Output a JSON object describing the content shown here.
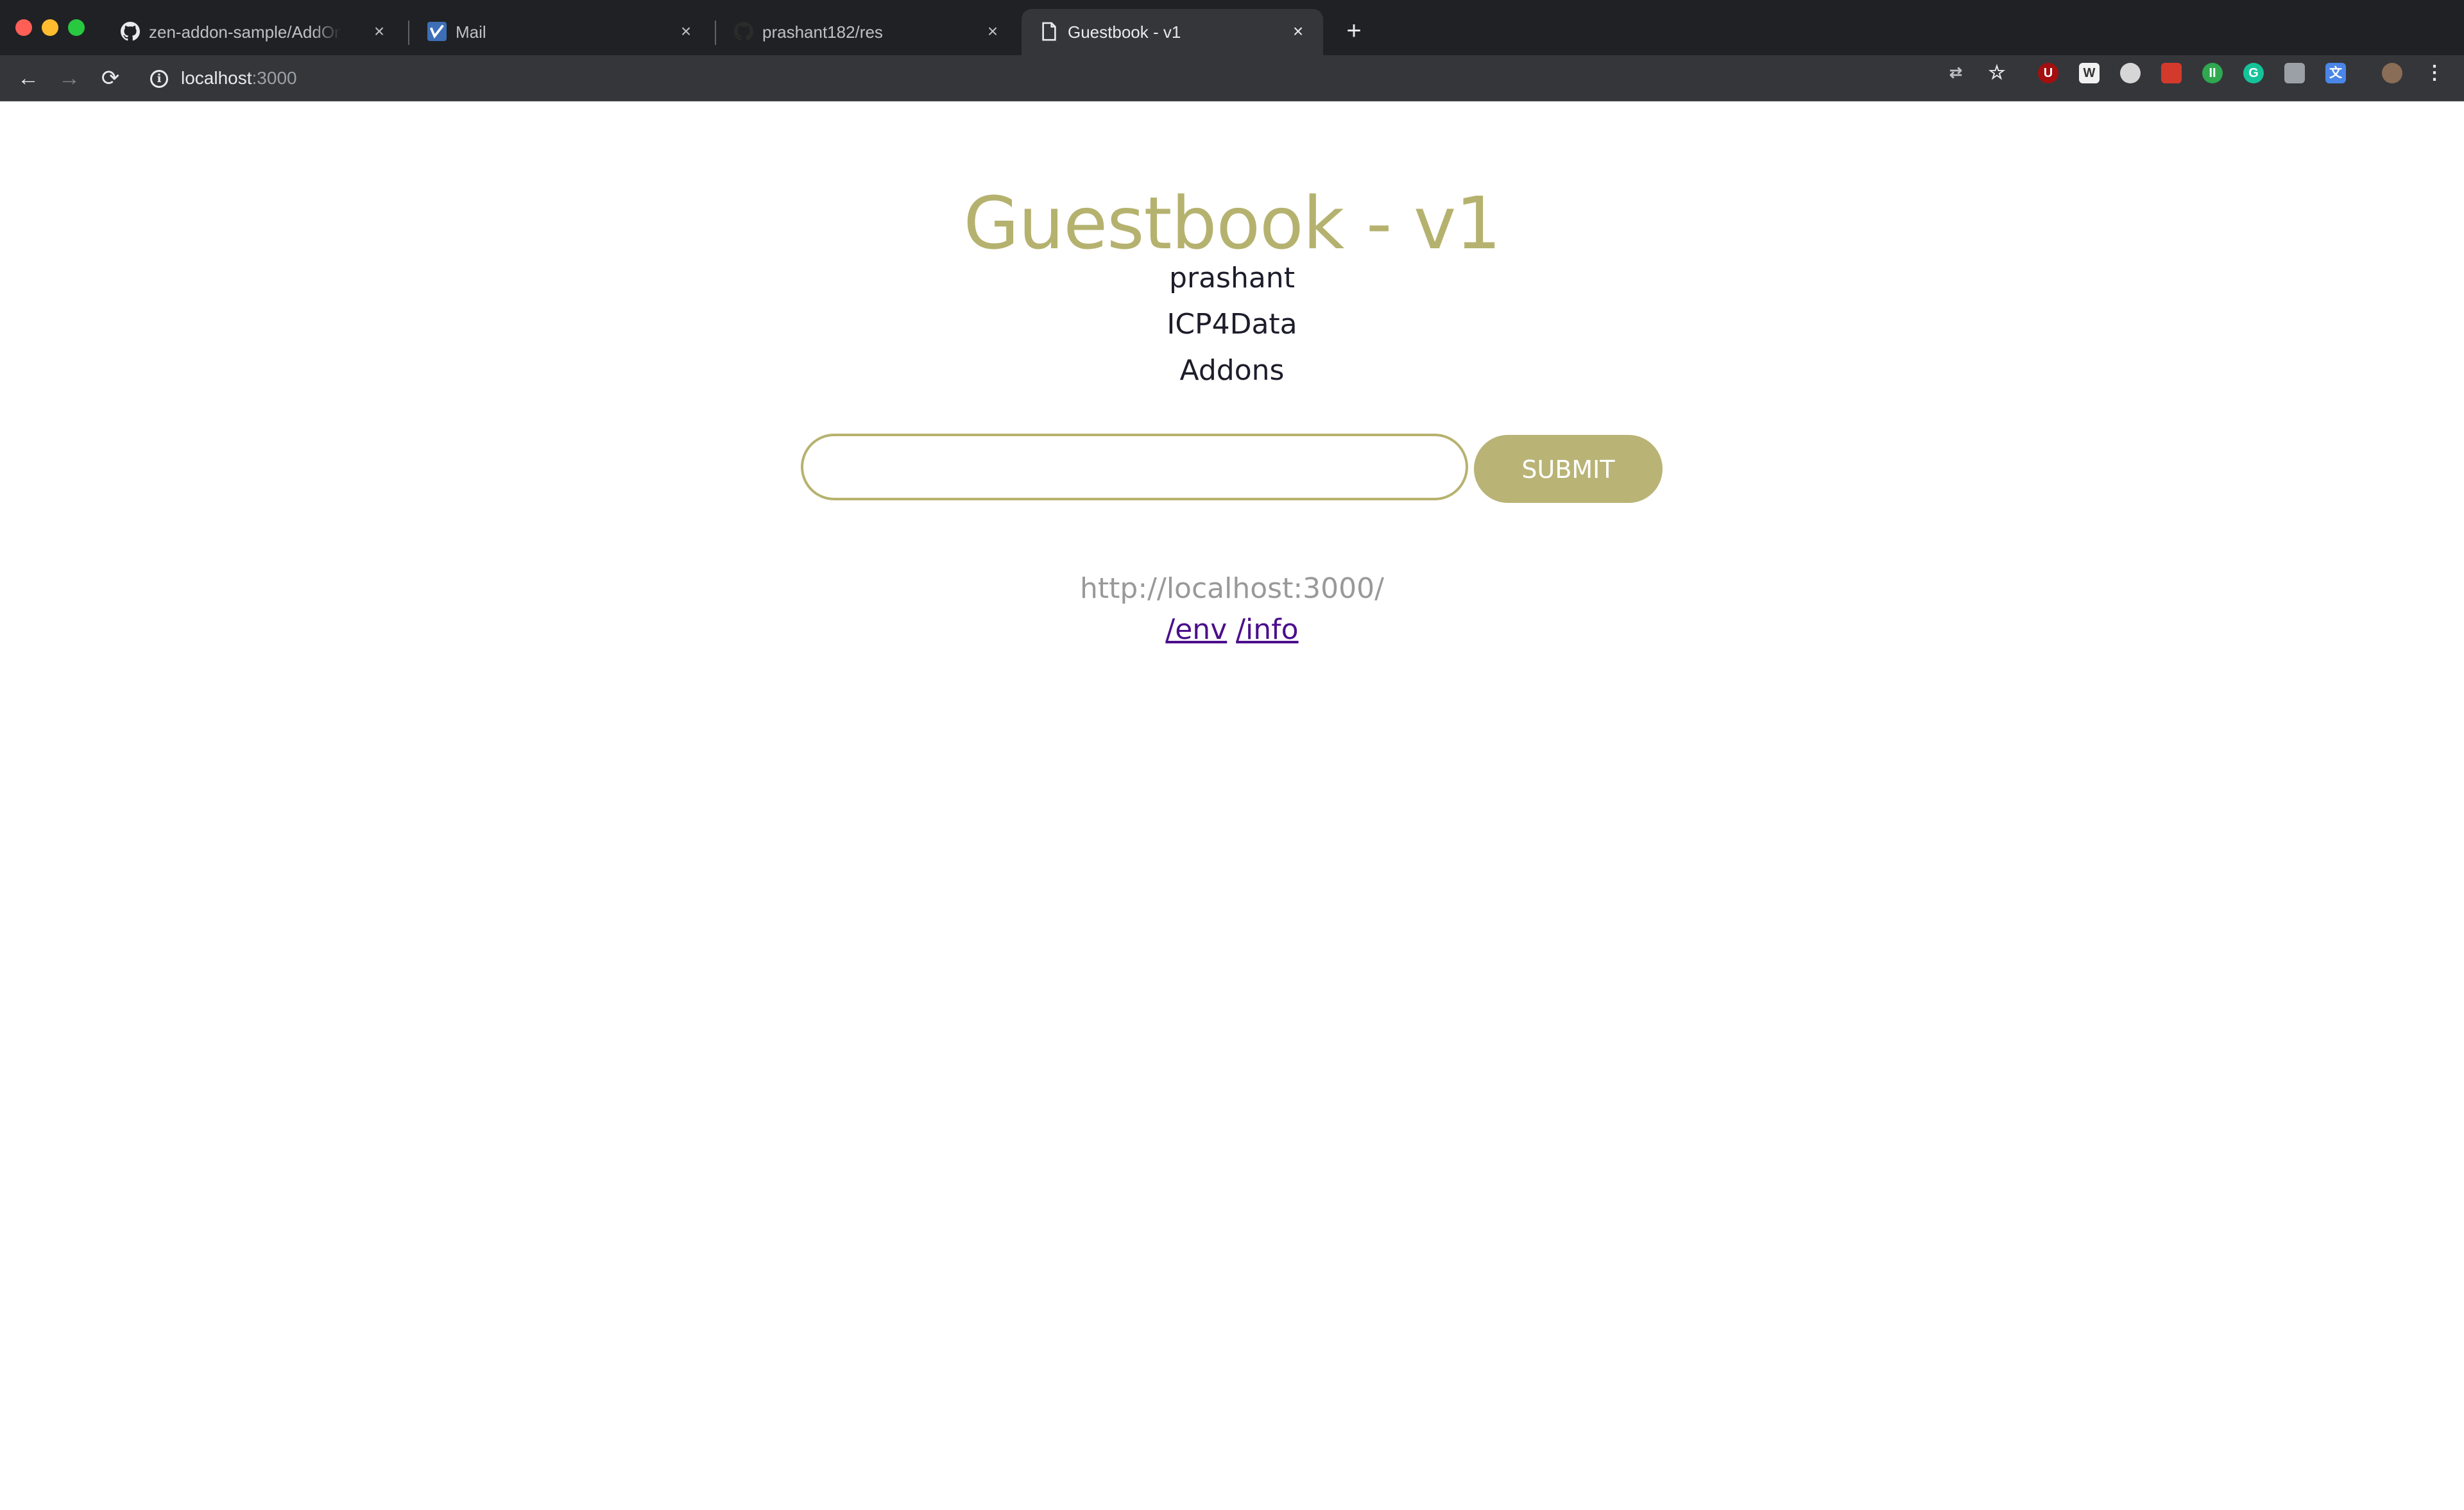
{
  "browser": {
    "tabs": [
      {
        "title": "zen-addon-sample/AddOnMetadata",
        "icon": "github-icon"
      },
      {
        "title": "Mail",
        "icon": "mail-app-icon"
      },
      {
        "title": "prashant182/res",
        "icon": "github-icon"
      },
      {
        "title": "Guestbook - v1",
        "icon": "document-icon",
        "active": true
      }
    ],
    "new_tab_label": "+",
    "address": {
      "host": "localhost",
      "port": ":3000"
    },
    "extensions": [
      "translate-icon",
      "star-icon",
      "ublock-icon",
      "w-extension-icon",
      "circle-extension-icon",
      "red-extension-icon",
      "green-extension-icon",
      "grammarly-icon",
      "printer-extension-icon",
      "google-translate-icon",
      "profile-avatar-icon",
      "kebab-menu-icon"
    ]
  },
  "page": {
    "title": "Guestbook - v1",
    "entries": [
      "prashant",
      "ICP4Data",
      "Addons"
    ],
    "input": {
      "value": "",
      "placeholder": ""
    },
    "submit_label": "SUBMIT",
    "host_address": "http://localhost:3000/",
    "links": [
      {
        "label": "/env"
      },
      {
        "label": "/info"
      }
    ]
  },
  "colors": {
    "accent": "#b7b26e",
    "entry_text": "#1d1d2b",
    "host_text": "#999999",
    "link": "#4b0f8c"
  }
}
